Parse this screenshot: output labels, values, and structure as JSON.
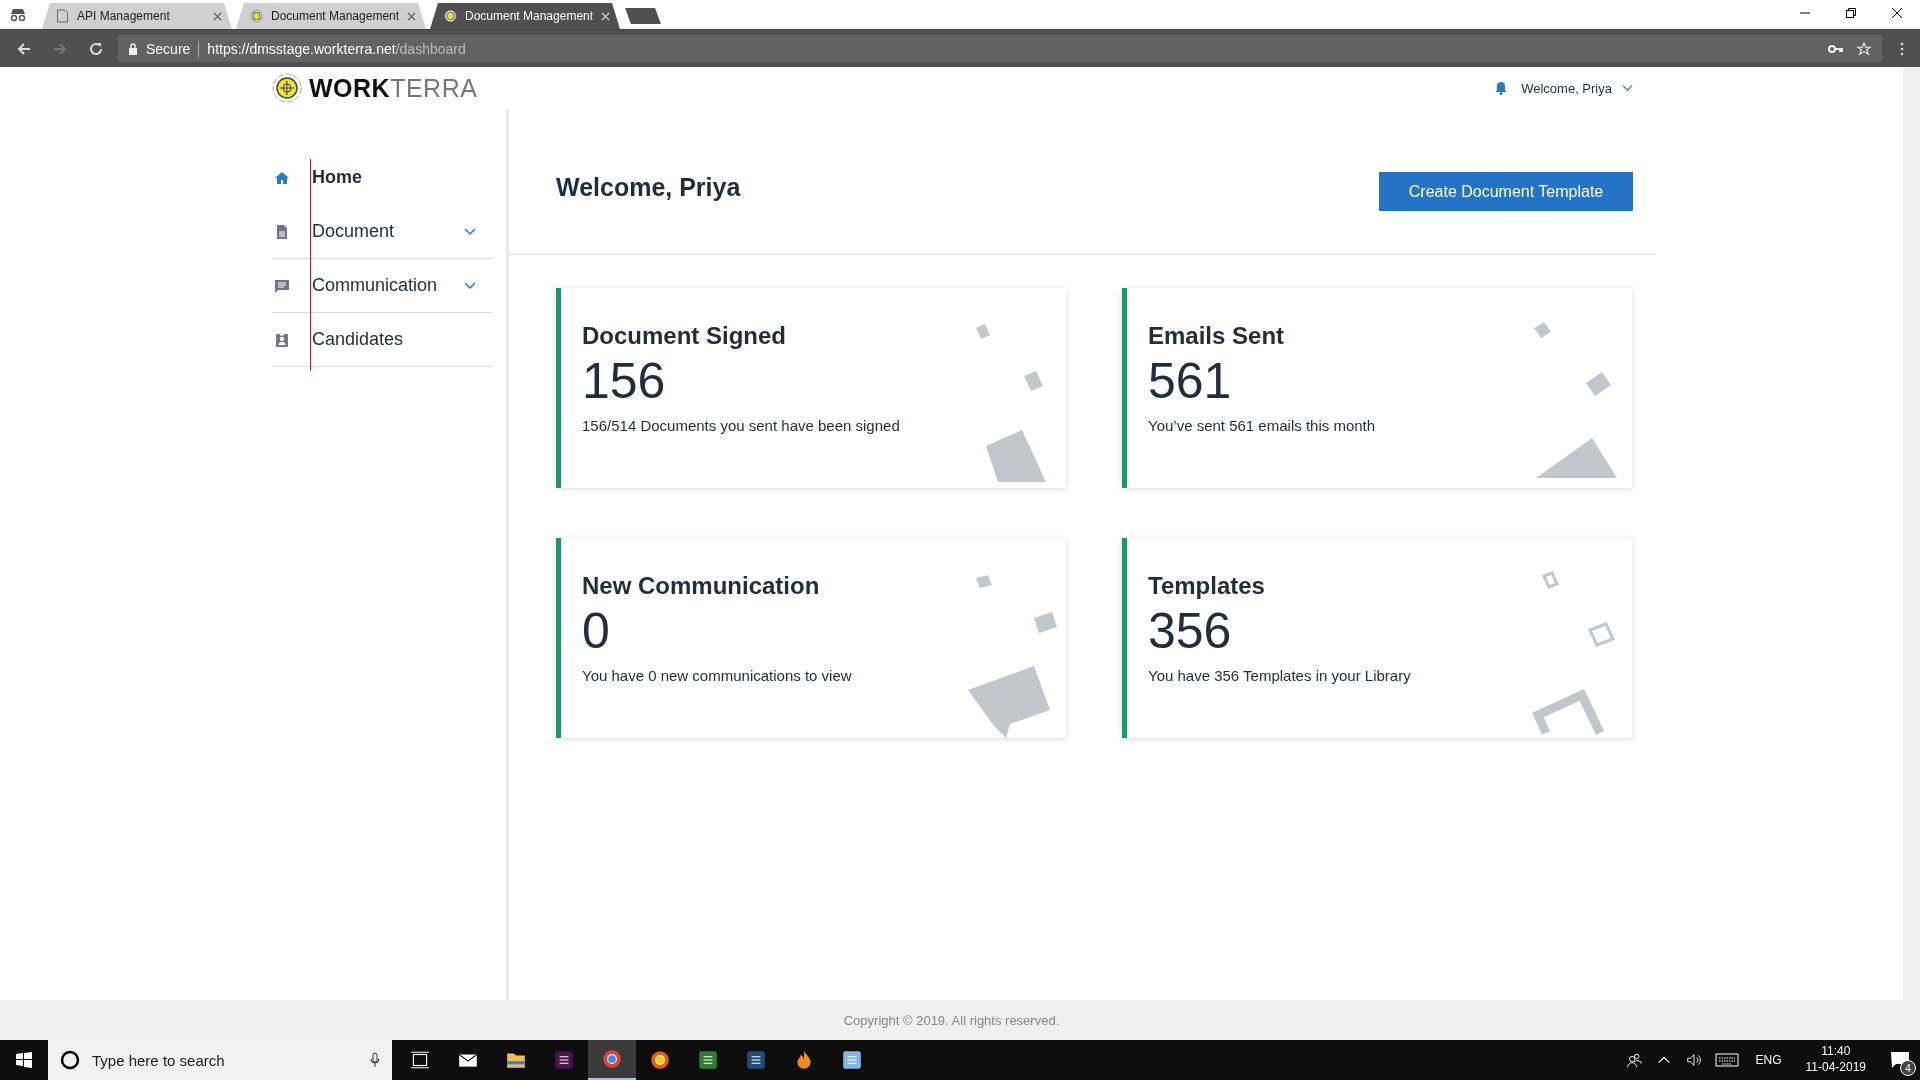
{
  "browser": {
    "tabs": [
      {
        "title": "API Management",
        "kind": "page",
        "selected": false
      },
      {
        "title": "Document Management",
        "kind": "logo",
        "selected": false
      },
      {
        "title": "Document Management",
        "kind": "logo",
        "selected": true
      }
    ],
    "address": {
      "secure_label": "Secure",
      "url_host": "https://dmsstage.workterra.net",
      "url_path": "/dashboard"
    }
  },
  "header": {
    "logo": {
      "bold": "WORK",
      "light": "TERRA"
    },
    "user": "Welcome, Priya"
  },
  "sidebar": {
    "items": [
      {
        "label": "Home",
        "kind": "home",
        "selected": true,
        "submenu": false
      },
      {
        "label": "Document",
        "kind": "document",
        "selected": false,
        "submenu": true
      },
      {
        "label": "Communication",
        "kind": "message",
        "selected": false,
        "submenu": true
      },
      {
        "label": "Candidates",
        "kind": "badge",
        "selected": false,
        "submenu": false
      }
    ]
  },
  "main": {
    "title": "Welcome, Priya",
    "button": "Create Document Template",
    "cards": [
      {
        "title": "Document Signed",
        "value": "156",
        "caption": "156/514 Documents you sent have been signed",
        "kind": "document"
      },
      {
        "title": "Emails Sent",
        "value": "561",
        "caption": "You’ve sent 561 emails this month",
        "kind": "mail"
      },
      {
        "title": "New Communication",
        "value": "0",
        "caption": "You have 0 new communications to view",
        "kind": "message"
      },
      {
        "title": "Templates",
        "value": "356",
        "caption": "You have 356 Templates in your Library",
        "kind": "copy"
      }
    ]
  },
  "footer": "Copyright © 2019. All rights reserved.",
  "taskbar": {
    "search_placeholder": "Type here to search",
    "apps": [
      {
        "kind": "taskview",
        "selected": false
      },
      {
        "kind": "mail",
        "selected": false
      },
      {
        "kind": "folder",
        "selected": false
      },
      {
        "kind": "slack",
        "selected": false
      },
      {
        "kind": "chrome",
        "selected": true
      },
      {
        "kind": "firefox",
        "selected": false
      },
      {
        "kind": "sheet",
        "selected": false
      },
      {
        "kind": "database",
        "selected": false
      },
      {
        "kind": "flame",
        "selected": false
      },
      {
        "kind": "notepad",
        "selected": false
      }
    ],
    "language": "ENG",
    "time": "11:40",
    "date": "11-04-2019",
    "notifications": "4"
  }
}
